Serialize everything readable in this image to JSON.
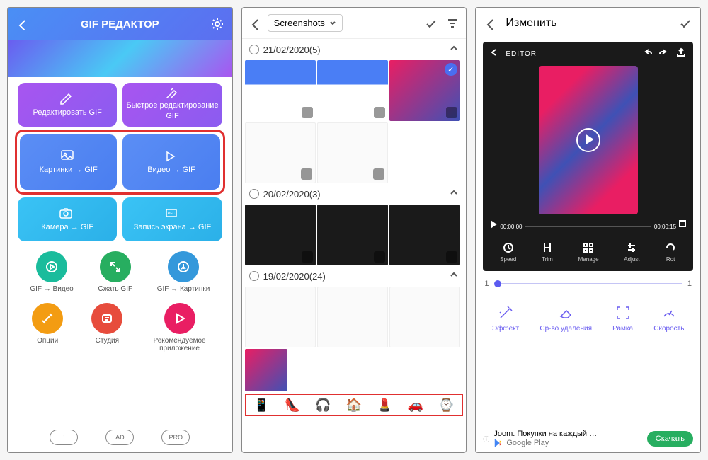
{
  "panel1": {
    "title": "GIF РЕДАКТОР",
    "tiles_top": [
      {
        "label": "Редактировать GIF",
        "icon": "edit"
      },
      {
        "label": "Быстрое редактирование GIF",
        "icon": "quick-edit"
      }
    ],
    "tiles_mid": [
      {
        "label": "Картинки → GIF",
        "icon": "image"
      },
      {
        "label": "Видео → GIF",
        "icon": "video"
      }
    ],
    "tiles_bot": [
      {
        "label": "Камера → GIF",
        "icon": "camera"
      },
      {
        "label": "Запись экрана → GIF",
        "icon": "rec"
      }
    ],
    "circles1": [
      {
        "label": "GIF → Видео",
        "color": "c-teal"
      },
      {
        "label": "Сжать GIF",
        "color": "c-green"
      },
      {
        "label": "GIF → Картинки",
        "color": "c-blue"
      }
    ],
    "circles2": [
      {
        "label": "Опции",
        "color": "c-orange"
      },
      {
        "label": "Студия",
        "color": "c-red"
      },
      {
        "label": "Рекомендуемое приложение",
        "color": "c-pink"
      }
    ],
    "footer": {
      "info": "!",
      "ad": "AD",
      "pro": "PRO"
    }
  },
  "panel2": {
    "folder": "Screenshots",
    "groups": [
      {
        "date": "21/02/2020",
        "count": "(5)"
      },
      {
        "date": "20/02/2020",
        "count": "(3)"
      },
      {
        "date": "19/02/2020",
        "count": "(24)"
      }
    ],
    "emojis": [
      "📱",
      "👠",
      "🎧",
      "🏠",
      "💄",
      "🚗",
      "⌚"
    ]
  },
  "panel3": {
    "title": "Изменить",
    "editor_label": "EDITOR",
    "time_start": "00:00:00",
    "time_end": "00:00:15",
    "ed_tools": [
      {
        "label": "Speed"
      },
      {
        "label": "Trim"
      },
      {
        "label": "Manage"
      },
      {
        "label": "Adjust"
      },
      {
        "label": "Rot"
      }
    ],
    "slider": {
      "min": "1",
      "max": "1"
    },
    "bottom_tools": [
      {
        "label": "Эффект"
      },
      {
        "label": "Ср-во удаления"
      },
      {
        "label": "Рамка"
      },
      {
        "label": "Скорость"
      }
    ],
    "ad": {
      "line1": "Joom. Покупки на каждый …",
      "store": "Google Play",
      "button": "Скачать"
    }
  }
}
